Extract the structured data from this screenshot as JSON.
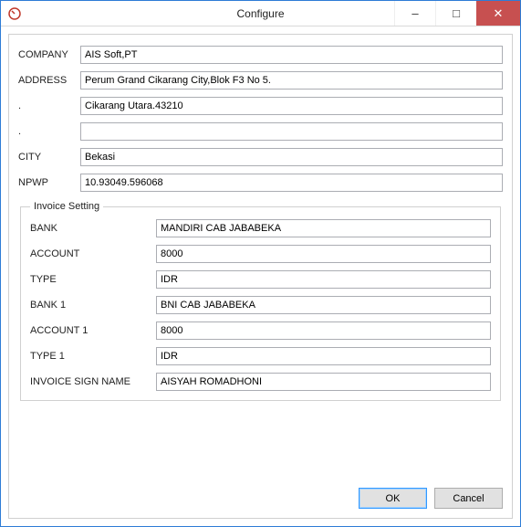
{
  "window": {
    "title": "Configure",
    "minimize": "–",
    "maximize": "□",
    "close": "✕"
  },
  "labels": {
    "company": "COMPANY",
    "address": "ADDRESS",
    "dot1": ".",
    "dot2": ".",
    "city": "CITY",
    "npwp": "NPWP"
  },
  "values": {
    "company": "AIS Soft,PT",
    "address": "Perum Grand Cikarang City,Blok F3 No 5.",
    "address2": "Cikarang Utara.43210",
    "address3": "",
    "city": "Bekasi",
    "npwp": "10.93049.596068"
  },
  "invoice": {
    "legend": "Invoice Setting",
    "labels": {
      "bank": "BANK",
      "account": "ACCOUNT",
      "type": "TYPE",
      "bank1": "BANK 1",
      "account1": "ACCOUNT 1",
      "type1": "TYPE 1",
      "sign": "INVOICE SIGN NAME"
    },
    "values": {
      "bank": "MANDIRI CAB JABABEKA",
      "account": "8000",
      "type": "IDR",
      "bank1": "BNI CAB JABABEKA",
      "account1": "8000",
      "type1": "IDR",
      "sign": "AISYAH ROMADHONI"
    }
  },
  "buttons": {
    "ok": "OK",
    "cancel": "Cancel"
  }
}
